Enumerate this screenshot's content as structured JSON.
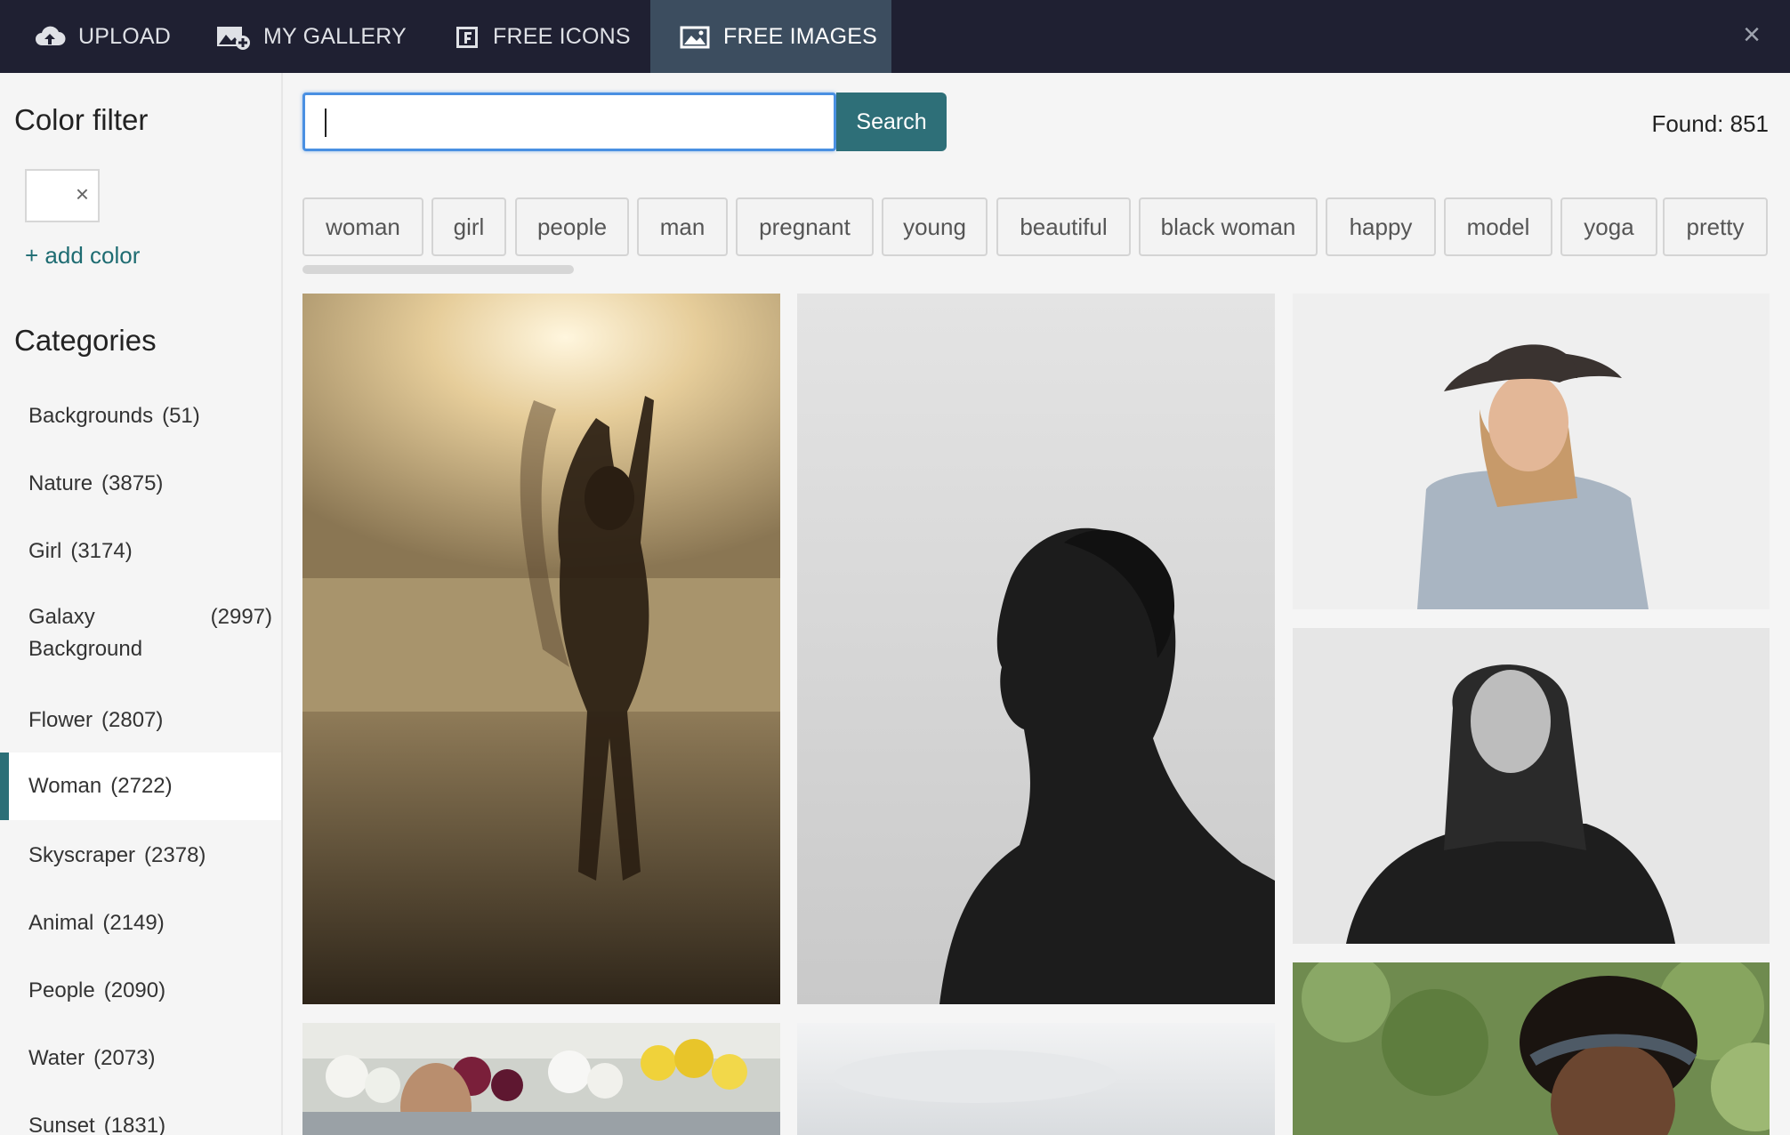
{
  "tabs": [
    {
      "label": "UPLOAD",
      "icon": "cloud-upload-icon"
    },
    {
      "label": "MY GALLERY",
      "icon": "gallery-icon"
    },
    {
      "label": "FREE ICONS",
      "icon": "icon-pack-icon"
    },
    {
      "label": "FREE IMAGES",
      "icon": "image-icon",
      "active": true
    }
  ],
  "close_icon": "×",
  "sidebar": {
    "color_filter_title": "Color filter",
    "color_chip_close": "×",
    "add_color": "+ add color",
    "categories_title": "Categories",
    "categories": [
      {
        "name": "Backgrounds",
        "count": "(51)"
      },
      {
        "name": "Nature",
        "count": "(3875)"
      },
      {
        "name": "Girl",
        "count": "(3174)"
      },
      {
        "name": "Galaxy Background",
        "count": "(2997)"
      },
      {
        "name": "Flower",
        "count": "(2807)"
      },
      {
        "name": "Woman",
        "count": "(2722)",
        "active": true
      },
      {
        "name": "Skyscraper",
        "count": "(2378)"
      },
      {
        "name": "Animal",
        "count": "(2149)"
      },
      {
        "name": "People",
        "count": "(2090)"
      },
      {
        "name": "Water",
        "count": "(2073)"
      },
      {
        "name": "Sunset",
        "count": "(1831)"
      }
    ]
  },
  "search": {
    "value": "",
    "button_label": "Search",
    "found": "Found: 851"
  },
  "tags": [
    "woman",
    "girl",
    "people",
    "man",
    "pregnant",
    "young",
    "beautiful",
    "black woman",
    "happy",
    "model",
    "yoga",
    "pretty"
  ],
  "colors": {
    "topbar": "#1f2032",
    "active_tab": "#3c4d5f",
    "accent": "#2e6f78",
    "focus": "#4a90e2"
  }
}
